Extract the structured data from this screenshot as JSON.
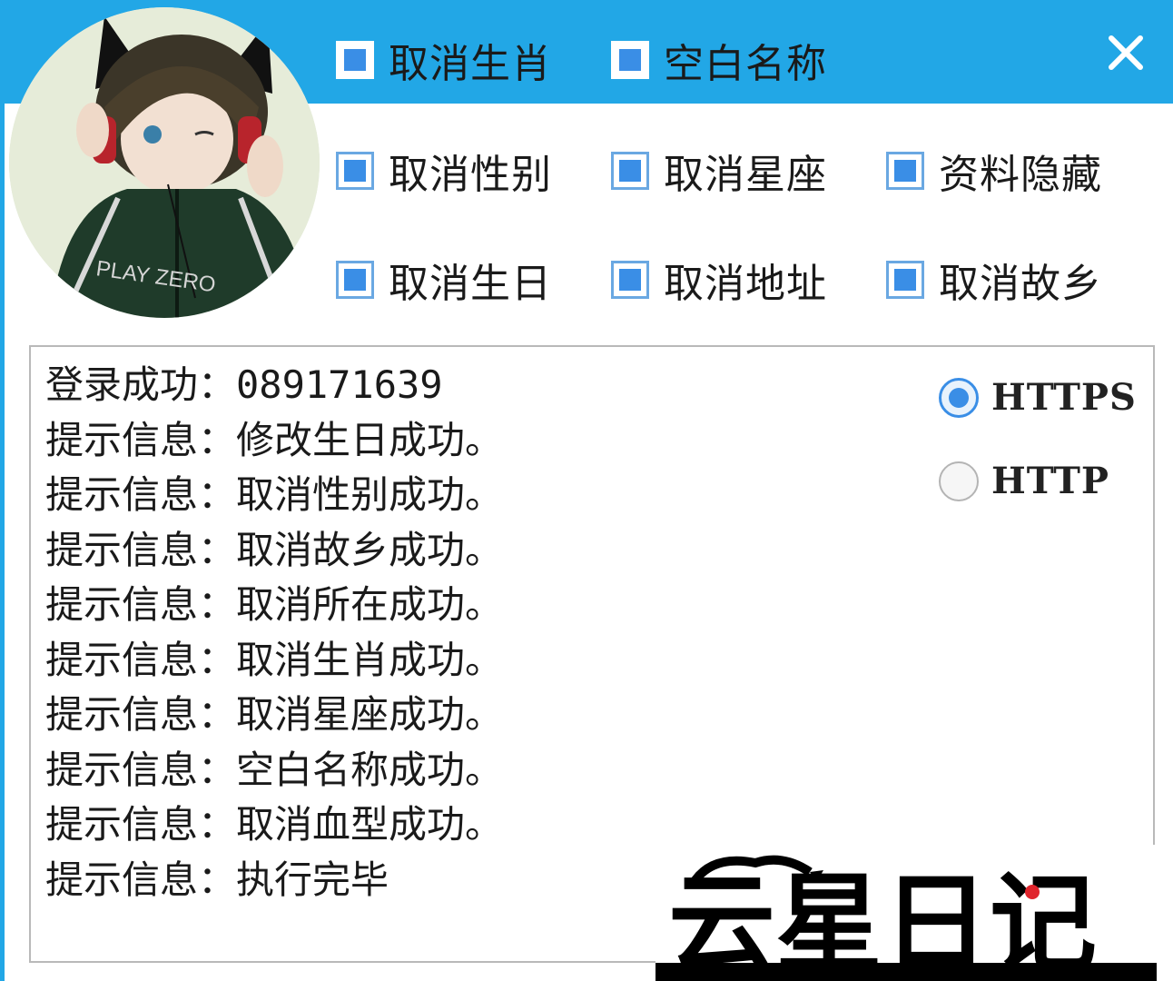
{
  "checkboxes": {
    "cancel_zodiac": {
      "label": "取消生肖",
      "checked": true
    },
    "blank_name": {
      "label": "空白名称",
      "checked": true
    },
    "cancel_gender": {
      "label": "取消性别",
      "checked": true
    },
    "cancel_constellation": {
      "label": "取消星座",
      "checked": true
    },
    "hide_profile": {
      "label": "资料隐藏",
      "checked": true
    },
    "cancel_birthday": {
      "label": "取消生日",
      "checked": true
    },
    "cancel_address": {
      "label": "取消地址",
      "checked": true
    },
    "cancel_hometown": {
      "label": "取消故乡",
      "checked": true
    }
  },
  "avatar": {
    "shirt_text": "PLAY ZERO"
  },
  "log": [
    "登录成功：089171639",
    "提示信息：修改生日成功。",
    "提示信息：取消性别成功。",
    "提示信息：取消故乡成功。",
    "提示信息：取消所在成功。",
    "提示信息：取消生肖成功。",
    "提示信息：取消星座成功。",
    "提示信息：空白名称成功。",
    "提示信息：取消血型成功。",
    "提示信息：执行完毕"
  ],
  "protocol": {
    "options": [
      "HTTPS",
      "HTTP"
    ],
    "selected": "HTTPS"
  },
  "watermark_text": "云星日记",
  "colors": {
    "titlebar": "#22a7e6",
    "checkbox_fill": "#3a8ee6",
    "checkbox_border": "#6aa8e2"
  },
  "icons": {
    "close": "close-icon",
    "checkbox": "checkbox-checked-icon",
    "radio": "radio-icon"
  }
}
